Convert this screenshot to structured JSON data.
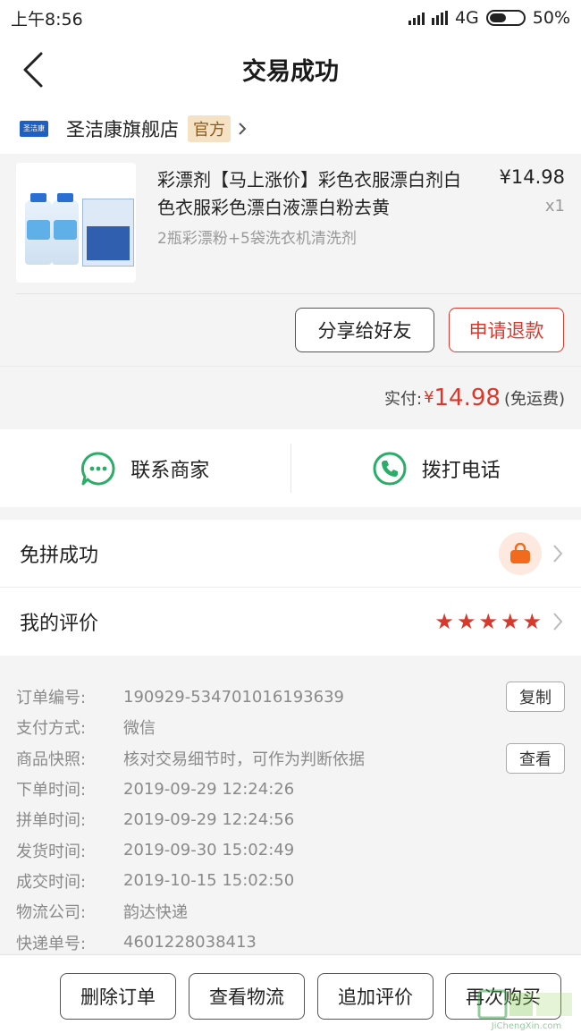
{
  "status_bar": {
    "time": "上午8:56",
    "network": "4G",
    "battery": "50%"
  },
  "header": {
    "title": "交易成功"
  },
  "shop": {
    "logo_text": "圣洁康",
    "name": "圣洁康旗舰店",
    "badge": "官方"
  },
  "product": {
    "name": "彩漂剂【马上涨价】彩色衣服漂白剂白色衣服彩色漂白液漂白粉去黄",
    "spec": "2瓶彩漂粉+5袋洗衣机清洗剂",
    "price": "¥14.98",
    "quantity": "x1",
    "share_label": "分享给好友",
    "refund_label": "申请退款"
  },
  "payment": {
    "label": "实付:",
    "currency": "¥",
    "amount": "14.98",
    "note": "(免运费)"
  },
  "contact": {
    "merchant_label": "联系商家",
    "call_label": "拨打电话"
  },
  "status_rows": {
    "group_label": "免拼成功",
    "review_label": "我的评价",
    "rating": 5
  },
  "order_info": {
    "rows": [
      {
        "key": "订单编号:",
        "value": "190929-534701016193639",
        "action": "复制"
      },
      {
        "key": "支付方式:",
        "value": "微信"
      },
      {
        "key": "商品快照:",
        "value": "核对交易细节时，可作为判断依据",
        "action": "查看"
      },
      {
        "key": "下单时间:",
        "value": "2019-09-29 12:24:26"
      },
      {
        "key": "拼单时间:",
        "value": "2019-09-29 12:24:56"
      },
      {
        "key": "发货时间:",
        "value": "2019-09-30 15:02:49"
      },
      {
        "key": "成交时间:",
        "value": "2019-10-15 15:02:50"
      },
      {
        "key": "物流公司:",
        "value": "韵达快递"
      },
      {
        "key": "快递单号:",
        "value": "4601228038413"
      }
    ]
  },
  "bottom_actions": {
    "delete": "删除订单",
    "logistics": "查看物流",
    "add_review": "追加评价",
    "buy_again": "再次购买"
  },
  "watermark": {
    "text": "JiChengXin.com"
  },
  "colors": {
    "accent_red": "#d9392c",
    "wechat_green": "#2aae67",
    "orange": "#f26a1b"
  }
}
